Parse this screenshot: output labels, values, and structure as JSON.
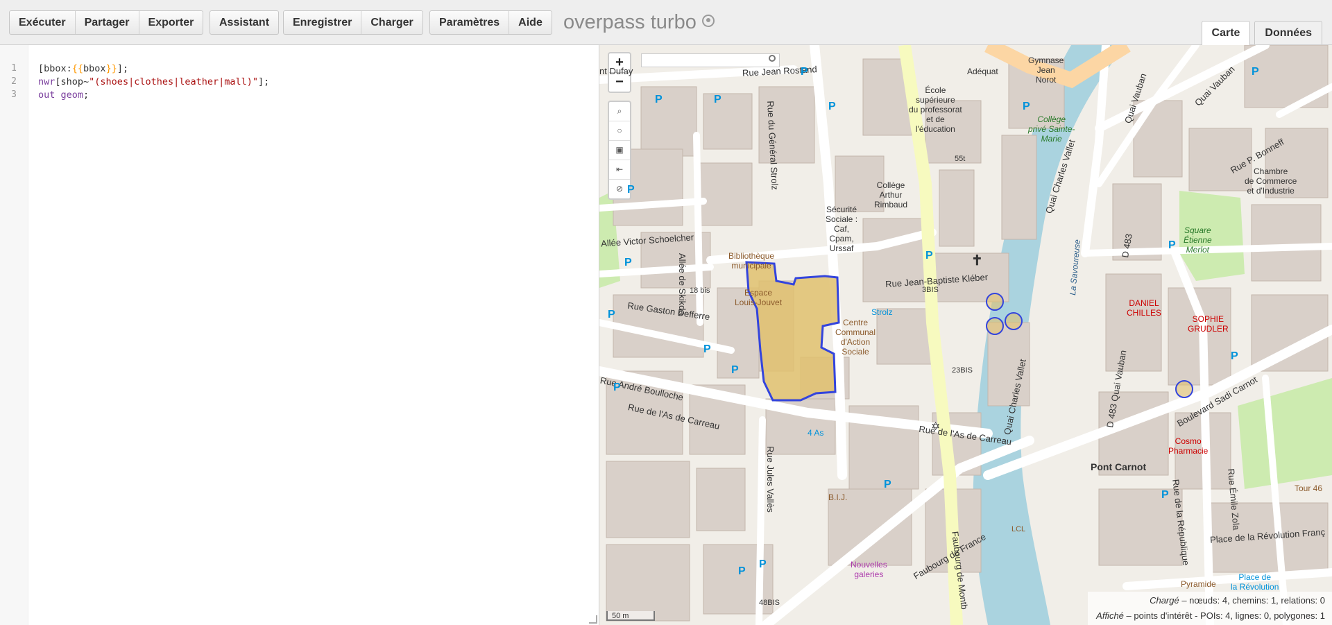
{
  "toolbar": {
    "group1": [
      "Exécuter",
      "Partager",
      "Exporter"
    ],
    "group2": [
      "Assistant"
    ],
    "group3": [
      "Enregistrer",
      "Charger"
    ],
    "group4": [
      "Paramètres",
      "Aide"
    ],
    "app_title": "overpass turbo"
  },
  "tabs": {
    "map": "Carte",
    "data": "Données"
  },
  "editor": {
    "line_numbers": [
      "1",
      "2",
      "3"
    ]
  },
  "map": {
    "zoom_in": "+",
    "zoom_out": "−",
    "scale_label": "50 m",
    "stats": {
      "loaded_label": "Chargé",
      "loaded_text": " – nœuds: 4, chemins: 1, relations: 0",
      "shown_label": "Affiché",
      "shown_text": " – points d'intérêt - POIs: 4, lignes: 0, polygones: 1"
    },
    "labels": {
      "rue_jean_rostand": "Rue Jean Rostand",
      "rue_general_strolz": "Rue du Général Strolz",
      "allee_schoelcher": "Allée Victor Schoelcher",
      "allee_skikda": "Allée de Skikda",
      "rue_gaston_defferre": "Rue Gaston Defferre",
      "rue_andre_boulloche": "Rue André Boulloche",
      "rue_as_de_carreau": "Rue de l'As de Carreau",
      "rue_as_de_carreau2": "Rue de l'As de Carreau",
      "rue_jb_kleber": "Rue Jean-Baptiste Kléber",
      "rue_jules_valles": "Rue Jules Vallès",
      "faubourg_france": "Faubourg de France",
      "faubourg_montbeliard": "Faubourg de Montb",
      "quai_vauban": "Quai Vauban",
      "quai_vauban2": "Quai Vauban",
      "quai_charles_vallet": "Quai Charles Vallet",
      "quai_charles_vallet2": "Quai Charles Vallet",
      "rue_p_bonneff": "Rue P. Bonneff",
      "d483": "D 483",
      "d483_quai_vauban": "D 483  Quai Vauban",
      "bd_sadi_carnot": "Boulevard Sadi Carnot",
      "rue_republique": "Rue de la République",
      "rue_emile_zola": "Rue Émile Zola",
      "place_revolution_francaise": "Place de la Révolution Franç",
      "pont_carnot": "Pont Carnot",
      "rue_dufay": "nt Dufay",
      "la_savoureuse": "La Savoureuse",
      "ecole_sup": "École\nsupérieure\ndu professorat\net de\nl'éducation",
      "adequat": "Adéquat",
      "gymnase": "Gymnase\nJean\nNorot",
      "college_prive": "Collège\nprivé Sainte-\nMarie",
      "college_arthur": "Collège\nArthur\nRimbaud",
      "securite_sociale": "Sécurité\nSociale :\nCaf,\nCpam,\nUrssaf",
      "bibliotheque": "Bibliothèque\nmunicipale",
      "espace_jouvet": "Espace\nLouis-Jouvet",
      "centre_communal": "Centre\nCommunal\nd'Action\nSociale",
      "strolz": "Strolz",
      "chambre_commerce": "Chambre\nde Commerce\net d'Industrie",
      "square_merlot": "Square\nÉtienne\nMerlot",
      "daniel_chilles": "DANIEL\nCHILLES",
      "sophie_grudler": "SOPHIE\nGRUDLER",
      "cosmo_pharmacie": "Cosmo\nPharmacie",
      "nouvelles_galeries": "Nouvelles\ngaleries",
      "bij": "B.I.J.",
      "tour46": "Tour 46",
      "pyramide": "Pyramide",
      "place_revolution": "Place de\nla Révolution",
      "stop_4as": "4 As",
      "lcl": "LCL",
      "n55t": "55t",
      "n3bis": "3BIS",
      "n23bis": "23BIS",
      "n18bis": "18 bis",
      "n48bis": "48BIS"
    }
  }
}
